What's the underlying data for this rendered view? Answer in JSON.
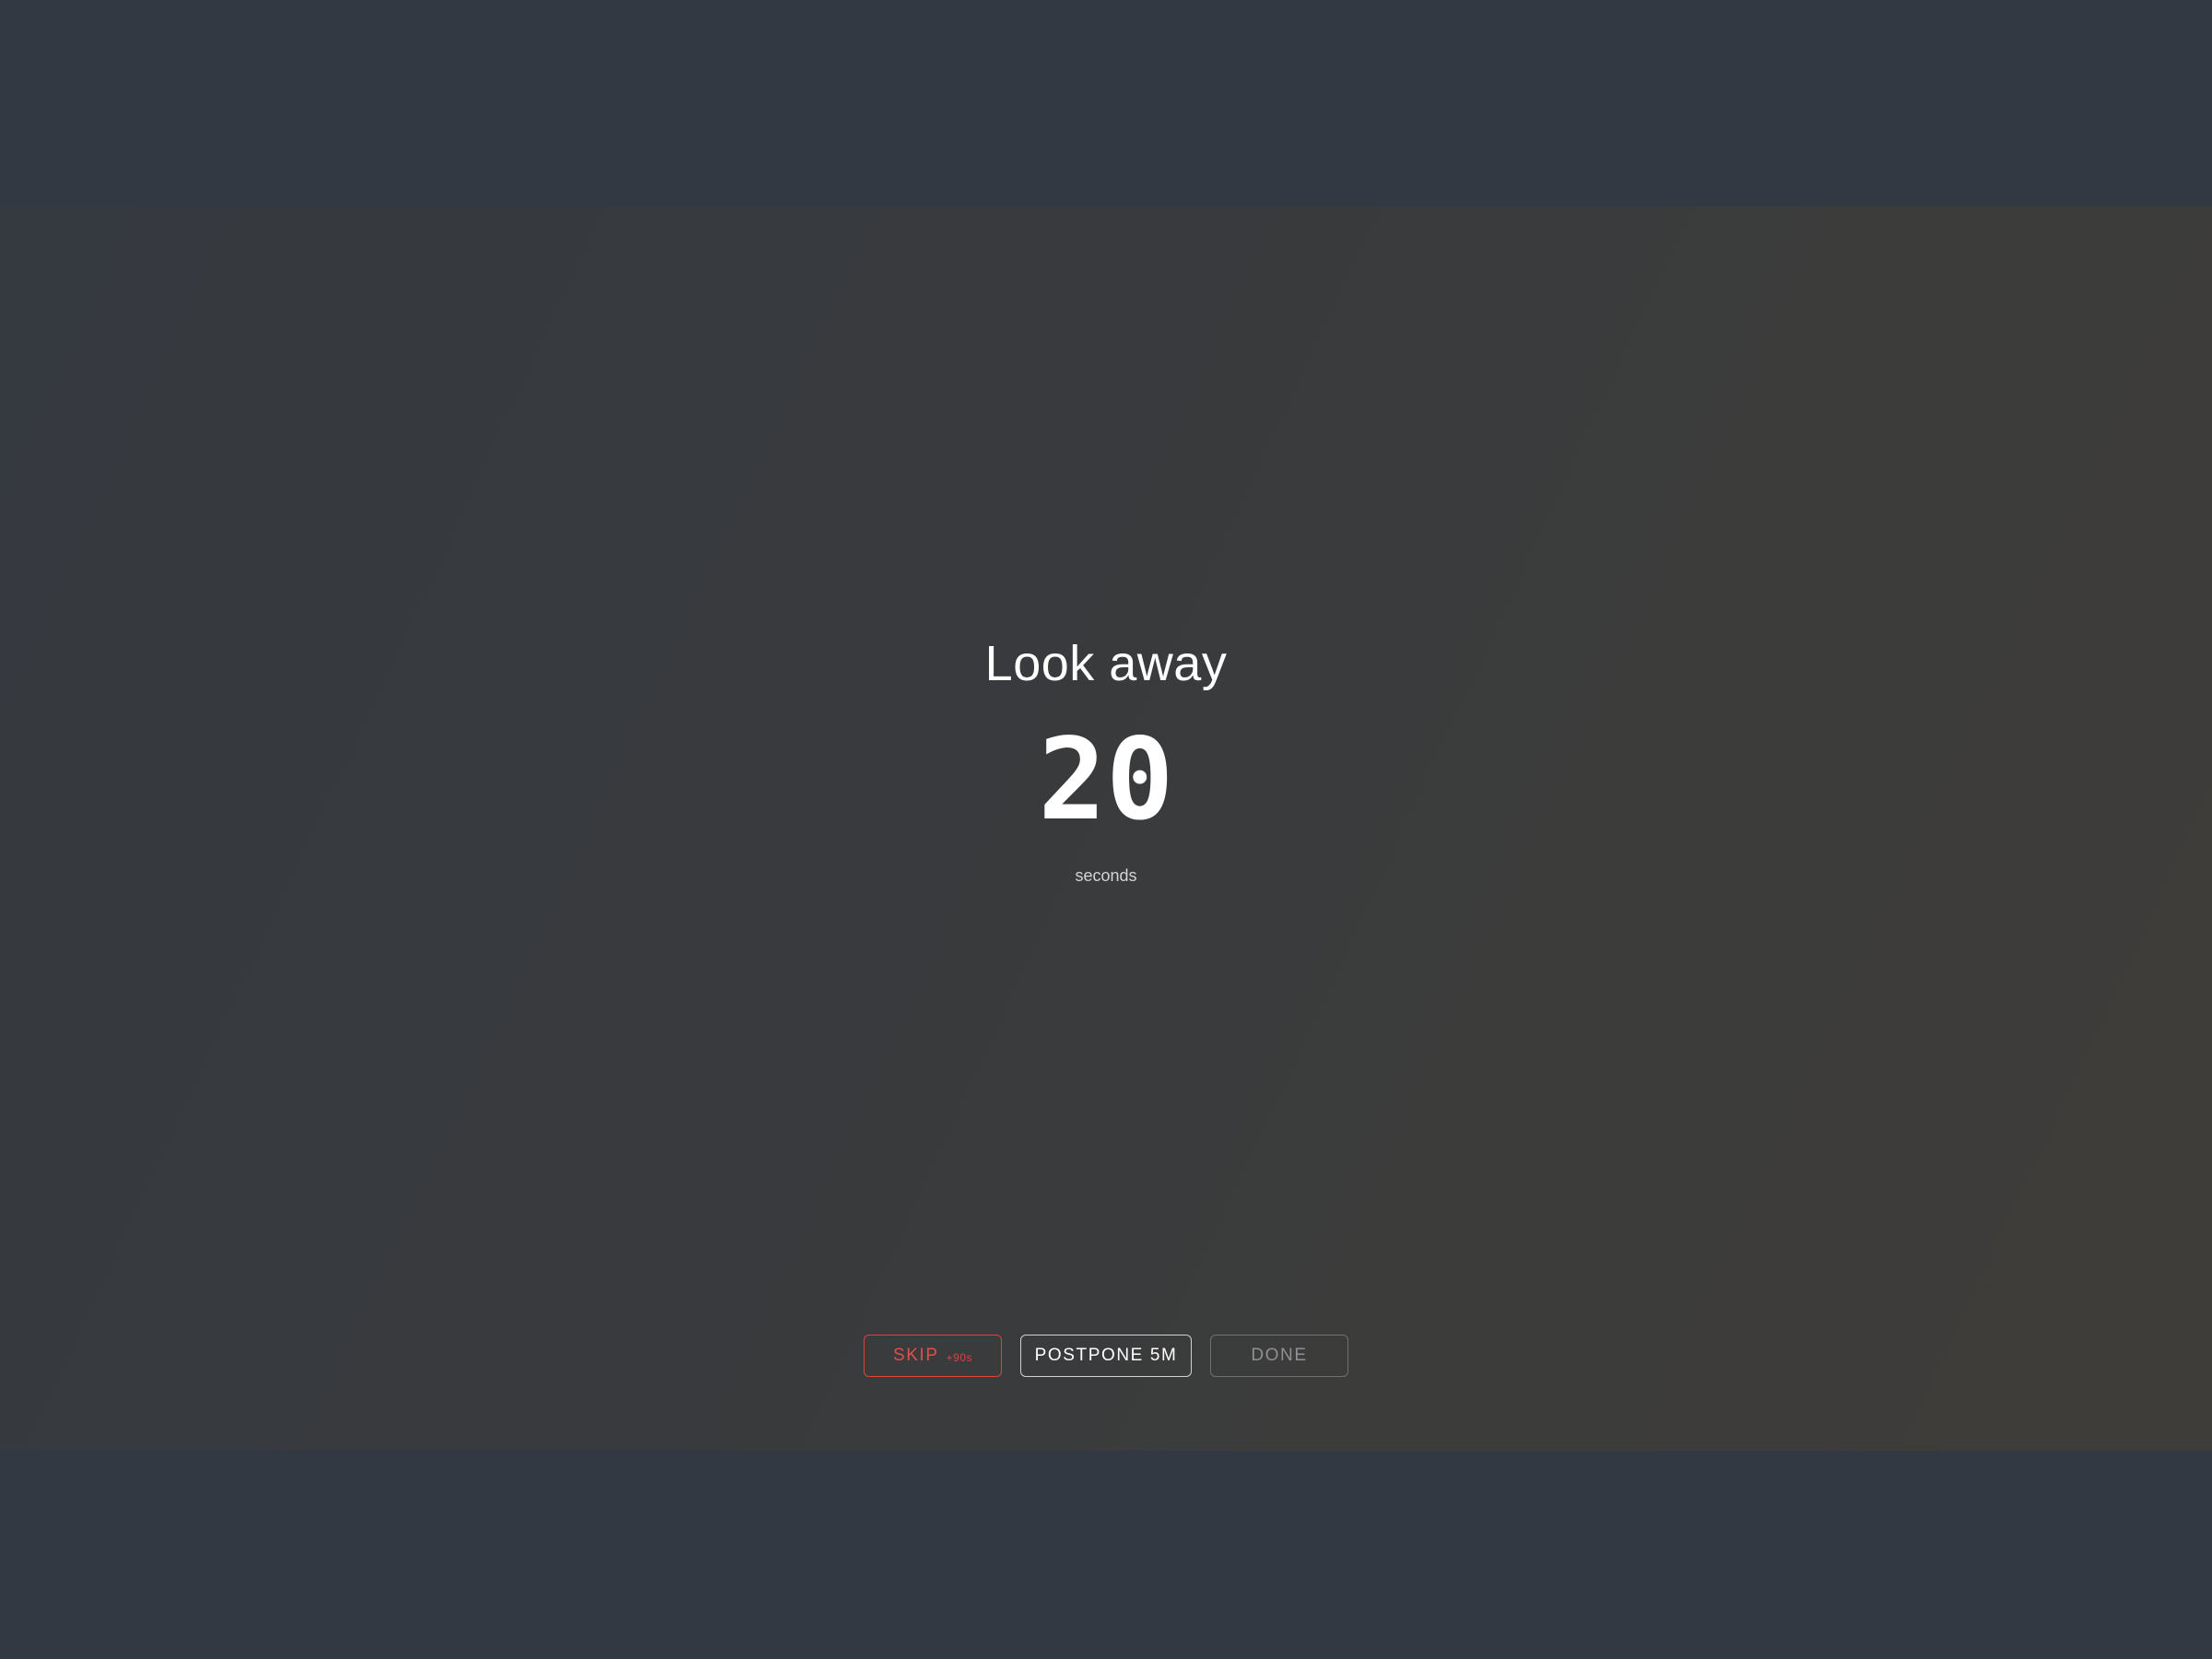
{
  "break_screen": {
    "title": "Look away",
    "countdown": {
      "value": "20",
      "unit": "seconds"
    },
    "actions": {
      "skip": {
        "label": "SKIP",
        "penalty": "+90s"
      },
      "postpone": {
        "label": "POSTPONE 5M"
      },
      "done": {
        "label": "DONE"
      }
    }
  },
  "colors": {
    "background": "#333942",
    "overlay": "#383a3d",
    "skip_accent": "#d9443f",
    "text": "#ffffff",
    "muted": "#8e9094"
  }
}
